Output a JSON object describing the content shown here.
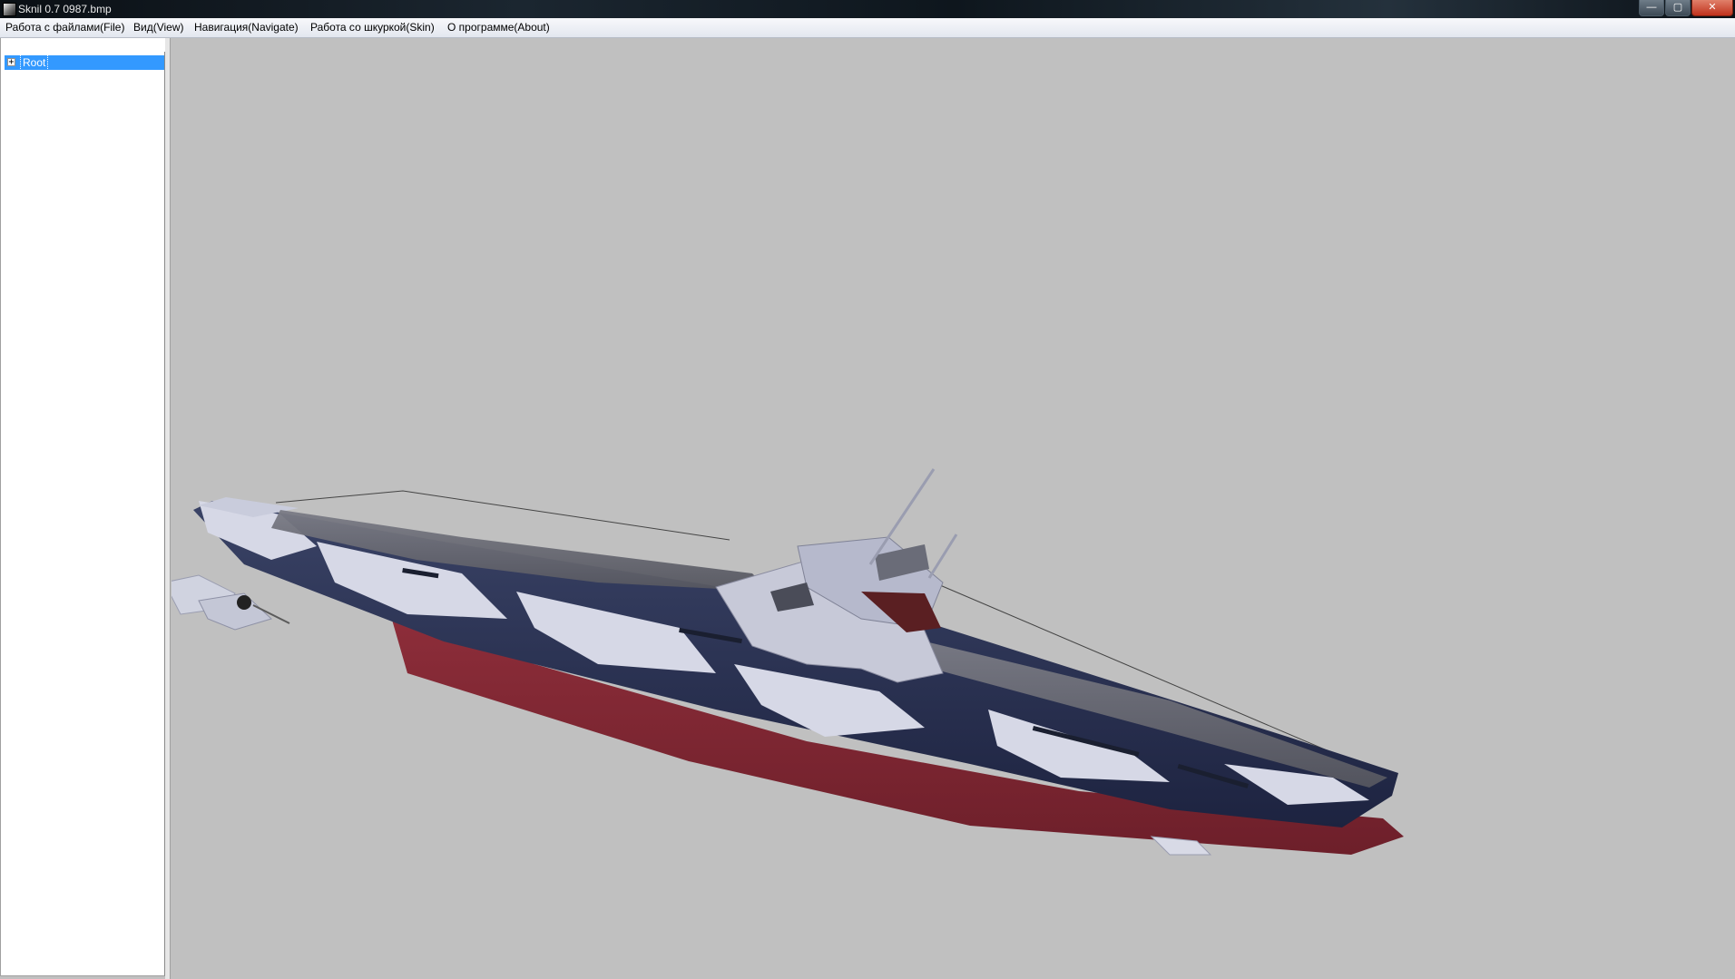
{
  "window": {
    "title": "Sknil 0.7   0987.bmp",
    "controls": {
      "minimize": "—",
      "maximize": "▢",
      "close": "✕"
    }
  },
  "menu": [
    {
      "label": "Работа с файлами(File)"
    },
    {
      "label": "Вид(View)"
    },
    {
      "label": "Навигация(Navigate)"
    },
    {
      "label": "Работа со шкуркой(Skin)"
    },
    {
      "label": "О программе(About)"
    }
  ],
  "tree": {
    "items": [
      {
        "label": "Root",
        "expander": "+",
        "selected": true
      }
    ]
  },
  "viewport": {
    "background": "#c0c0c0",
    "model": "submarine-model",
    "colors": {
      "hull_lower": "#8a2a36",
      "hull_upper": "#2a3152",
      "camo_light": "#d6d8e6",
      "deck": "#6a6a72"
    }
  },
  "colors": {
    "selection": "#3399ff",
    "panel": "#ffffff",
    "menubar": "#eef0f5"
  }
}
